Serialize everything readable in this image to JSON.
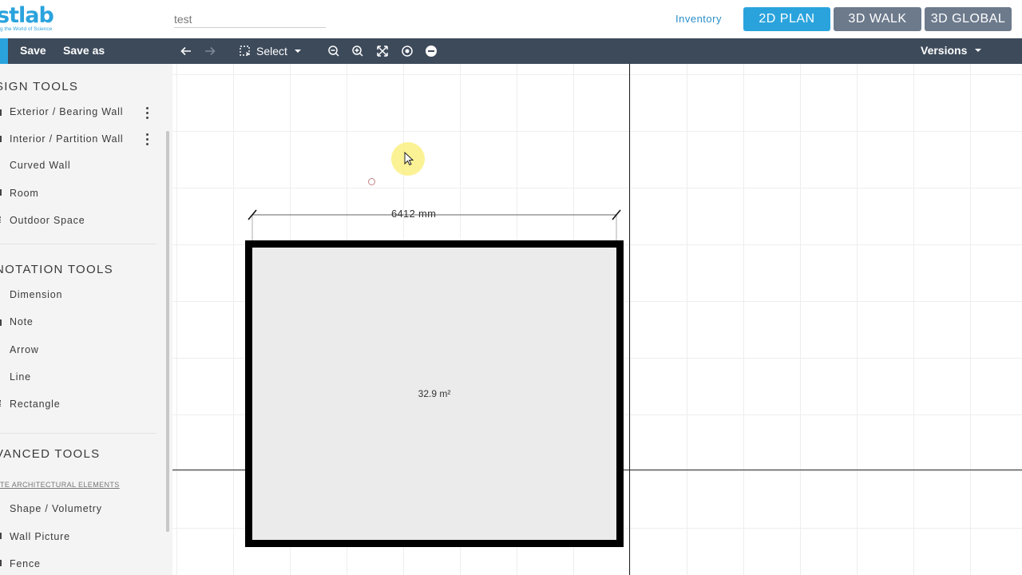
{
  "app": {
    "logo_text": "stlab",
    "logo_tagline": "g the World of Science",
    "project_title": "test"
  },
  "header": {
    "inventory_label": "Inventory",
    "views": [
      "2D PLAN",
      "3D WALK",
      "3D GLOBAL"
    ],
    "active_view": "2D PLAN"
  },
  "toolbar": {
    "save_label": "Save",
    "save_as_label": "Save as",
    "select_label": "Select",
    "versions_label": "Versions",
    "icons": [
      "undo-arrow-icon",
      "redo-arrow-icon",
      "select-marquee-icon",
      "zoom-out-icon",
      "zoom-in-icon",
      "fit-screen-icon",
      "center-target-icon",
      "minus-circle-icon"
    ]
  },
  "sidebar": {
    "design_title": "SIGN TOOLS",
    "design_items": [
      {
        "label": "Exterior / Bearing Wall"
      },
      {
        "label": "Interior / Partition Wall"
      },
      {
        "label": "Curved Wall"
      },
      {
        "label": "Room"
      },
      {
        "label": "Outdoor Space"
      }
    ],
    "annotation_title": "NOTATION TOOLS",
    "annotation_items": [
      {
        "label": "Dimension"
      },
      {
        "label": "Note"
      },
      {
        "label": "Arrow"
      },
      {
        "label": "Line"
      },
      {
        "label": "Rectangle"
      }
    ],
    "advanced_title": "VANCED TOOLS",
    "advanced_link": "TE ARCHITECTURAL ELEMENTS",
    "advanced_items": [
      {
        "label": "Shape / Volumetry"
      },
      {
        "label": "Wall Picture"
      },
      {
        "label": "Fence"
      }
    ]
  },
  "canvas": {
    "dimension_label": "6412 mm",
    "area_label": "32.9 m²"
  },
  "colors": {
    "accent": "#2aa3dd",
    "toolbar_bg": "#3d4a5a",
    "inactive_view": "#6c7a8c",
    "sidebar_bg": "#f4f4f4"
  }
}
